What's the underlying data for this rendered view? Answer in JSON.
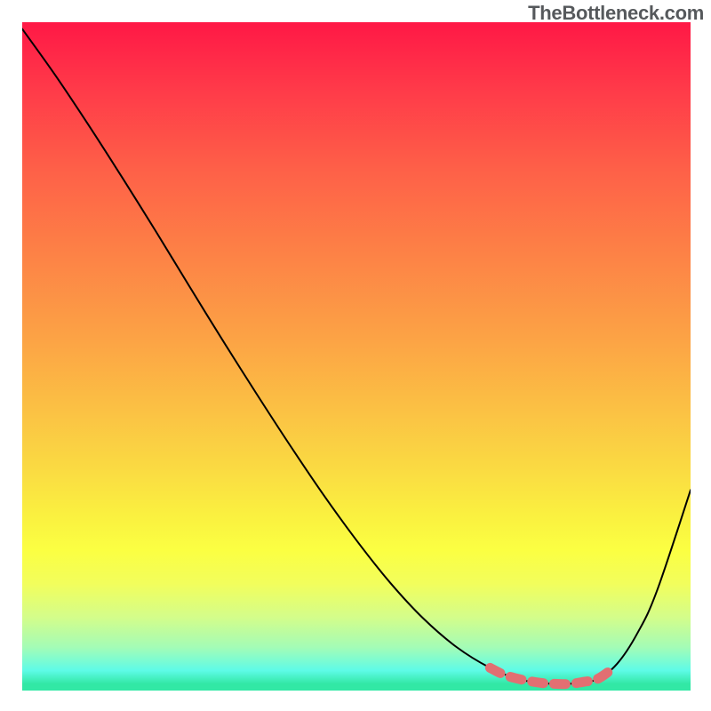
{
  "watermark": "TheBottleneck.com",
  "chart_data": {
    "type": "line",
    "title": "",
    "xlabel": "",
    "ylabel": "",
    "xlim": [
      0,
      100
    ],
    "ylim": [
      0,
      100
    ],
    "grid": false,
    "legend": false,
    "series": [
      {
        "name": "bottleneck-curve",
        "color": "#000000",
        "x": [
          0,
          5,
          10,
          15,
          20,
          25,
          30,
          35,
          40,
          45,
          50,
          55,
          60,
          65,
          70,
          74,
          77,
          80,
          83,
          86,
          89,
          92,
          95,
          100
        ],
        "y": [
          99,
          92,
          84.5,
          76.7,
          68.7,
          60.5,
          52.4,
          44.5,
          36.8,
          29.4,
          22.5,
          16.2,
          10.8,
          6.5,
          3.4,
          1.8,
          1.2,
          1.0,
          1.1,
          1.7,
          4.0,
          8.5,
          15,
          30
        ]
      },
      {
        "name": "optimal-band-marker",
        "color": "#e26f72",
        "x": [
          70,
          72,
          74,
          76,
          78,
          80,
          82,
          84,
          86,
          88
        ],
        "y": [
          3.4,
          2.4,
          1.8,
          1.4,
          1.1,
          1.0,
          1.0,
          1.3,
          1.7,
          3.0
        ]
      }
    ],
    "gradient_stops": [
      {
        "pos": 0,
        "color": "#ff1846"
      },
      {
        "pos": 0.22,
        "color": "#fe6048"
      },
      {
        "pos": 0.47,
        "color": "#fca245"
      },
      {
        "pos": 0.74,
        "color": "#faf140"
      },
      {
        "pos": 0.89,
        "color": "#d4fd8a"
      },
      {
        "pos": 0.97,
        "color": "#5efbe7"
      },
      {
        "pos": 1.0,
        "color": "#32e8a5"
      }
    ]
  }
}
